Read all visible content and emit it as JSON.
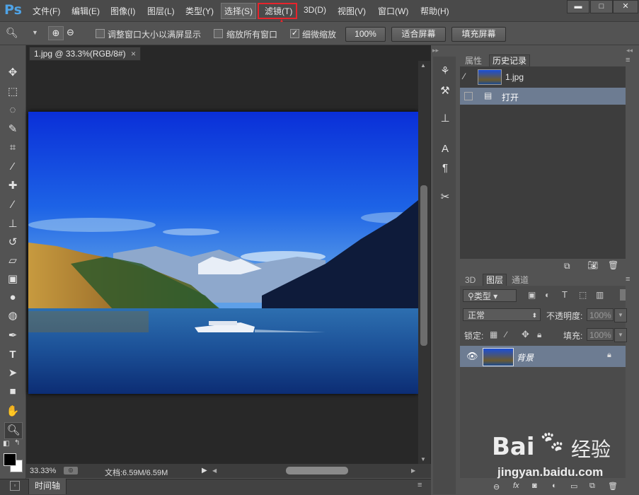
{
  "app": {
    "logo": "Ps",
    "menu": [
      "文件(F)",
      "编辑(E)",
      "图像(I)",
      "图层(L)",
      "类型(Y)",
      "选择(S)",
      "滤镜(T)",
      "3D(D)",
      "视图(V)",
      "窗口(W)",
      "帮助(H)"
    ],
    "highlighted_menu": "滤镜(T)",
    "annotation_color": "#e8242c"
  },
  "options": {
    "fit_window_label": "调整窗口大小以满屏显示",
    "zoom_all_label": "缩放所有窗口",
    "scrubby_label": "细微缩放",
    "zoom_100": "100%",
    "fit_screen": "适合屏幕",
    "fill_screen": "填充屏幕"
  },
  "document": {
    "tab_title": "1.jpg @ 33.3%(RGB/8#)",
    "zoom": "33.33%",
    "doc_info": "文档:6.59M/6.59M",
    "timeline": "时间轴"
  },
  "history_panel": {
    "tabs": [
      "属性",
      "历史记录"
    ],
    "snapshot_name": "1.jpg",
    "items": [
      "打开"
    ]
  },
  "layers_panel": {
    "tabs": [
      "3D",
      "图层",
      "通道"
    ],
    "filter_kind": "类型",
    "blend_mode": "正常",
    "opacity_label": "不透明度:",
    "opacity_value": "100%",
    "lock_label": "锁定:",
    "fill_label": "填充:",
    "fill_value": "100%",
    "layer_name": "背景"
  },
  "watermark": {
    "brand": "Bai",
    "brand2": "经验",
    "url": "jingyan.baidu.com"
  }
}
